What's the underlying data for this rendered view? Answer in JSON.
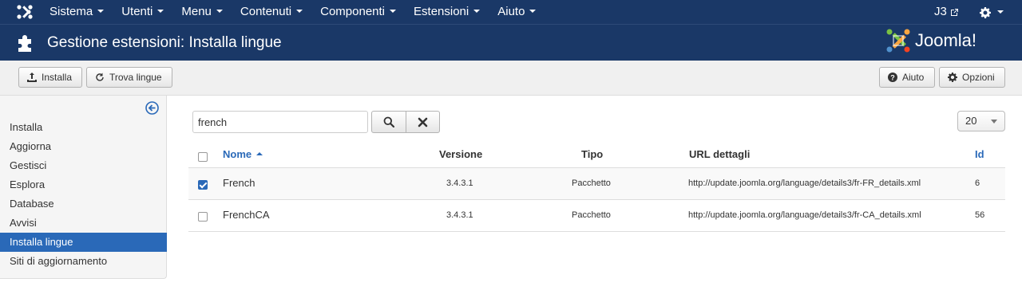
{
  "navbar": {
    "menus": [
      {
        "label": "Sistema"
      },
      {
        "label": "Utenti"
      },
      {
        "label": "Menu"
      },
      {
        "label": "Contenuti"
      },
      {
        "label": "Componenti"
      },
      {
        "label": "Estensioni"
      },
      {
        "label": "Aiuto"
      }
    ],
    "site_label": "J3",
    "icons": {
      "logo": "joomla-logo-icon",
      "external": "external-link-icon",
      "settings": "gear-icon"
    }
  },
  "header": {
    "title": "Gestione estensioni: Installa lingue",
    "brand_text": "Joomla!",
    "icon": "puzzle-icon"
  },
  "toolbar": {
    "install_label": "Installa",
    "find_languages_label": "Trova lingue",
    "help_label": "Aiuto",
    "options_label": "Opzioni"
  },
  "sidebar": {
    "items": [
      {
        "label": "Installa",
        "active": false
      },
      {
        "label": "Aggiorna",
        "active": false
      },
      {
        "label": "Gestisci",
        "active": false
      },
      {
        "label": "Esplora",
        "active": false
      },
      {
        "label": "Database",
        "active": false
      },
      {
        "label": "Avvisi",
        "active": false
      },
      {
        "label": "Installa lingue",
        "active": true
      },
      {
        "label": "Siti di aggiornamento",
        "active": false
      }
    ]
  },
  "search": {
    "value": "french",
    "limit": "20"
  },
  "table": {
    "columns": {
      "name": "Nome",
      "version": "Versione",
      "type": "Tipo",
      "url": "URL dettagli",
      "id": "Id"
    },
    "rows": [
      {
        "checked": true,
        "name": "French",
        "version": "3.4.3.1",
        "type": "Pacchetto",
        "url": "http://update.joomla.org/language/details3/fr-FR_details.xml",
        "id": "6"
      },
      {
        "checked": false,
        "name": "FrenchCA",
        "version": "3.4.3.1",
        "type": "Pacchetto",
        "url": "http://update.joomla.org/language/details3/fr-CA_details.xml",
        "id": "56"
      }
    ]
  },
  "colors": {
    "navbar": "#1a3867",
    "accent": "#2a69b8",
    "brand_orange": "#f9a541",
    "brand_green": "#7ac143",
    "brand_red": "#f44321",
    "brand_blue": "#5091cd"
  }
}
